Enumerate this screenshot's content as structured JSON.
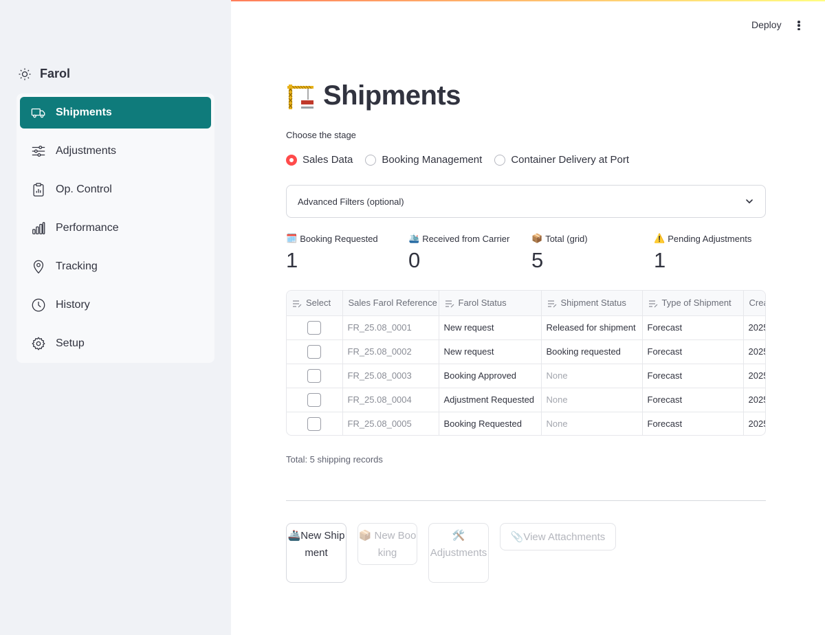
{
  "app": {
    "brand": "Farol"
  },
  "header": {
    "deploy_label": "Deploy"
  },
  "sidebar": {
    "items": [
      {
        "label": "Shipments",
        "icon": "truck-icon",
        "active": true
      },
      {
        "label": "Adjustments",
        "icon": "sliders-icon"
      },
      {
        "label": "Op. Control",
        "icon": "clipboard-icon"
      },
      {
        "label": "Performance",
        "icon": "bar-chart-icon"
      },
      {
        "label": "Tracking",
        "icon": "map-pin-icon"
      },
      {
        "label": "History",
        "icon": "clock-icon"
      },
      {
        "label": "Setup",
        "icon": "gear-icon"
      }
    ]
  },
  "page": {
    "title": "Shipments",
    "title_emoji": "🏗️",
    "stage_label": "Choose the stage",
    "stages": [
      "Sales Data",
      "Booking Management",
      "Container Delivery at Port"
    ],
    "selected_stage": "Sales Data",
    "filters_label": "Advanced Filters (optional)"
  },
  "metrics": [
    {
      "emoji": "🗓️",
      "label": "Booking Requested",
      "value": "1"
    },
    {
      "emoji": "🛳️",
      "label": "Received from Carrier",
      "value": "0"
    },
    {
      "emoji": "📦",
      "label": "Total (grid)",
      "value": "5"
    },
    {
      "emoji": "⚠️",
      "label": "Pending Adjustments",
      "value": "1"
    }
  ],
  "grid": {
    "columns": [
      "Select",
      "Sales Farol Reference",
      "Farol Status",
      "Shipment Status",
      "Type of Shipment",
      "Crea"
    ],
    "rows": [
      [
        "FR_25.08_0001",
        "New request",
        "Released for shipment",
        "Forecast",
        "2025"
      ],
      [
        "FR_25.08_0002",
        "New request",
        "Booking requested",
        "Forecast",
        "2025"
      ],
      [
        "FR_25.08_0003",
        "Booking Approved",
        "None",
        "Forecast",
        "2025"
      ],
      [
        "FR_25.08_0004",
        "Adjustment Requested",
        "None",
        "Forecast",
        "2025"
      ],
      [
        "FR_25.08_0005",
        "Booking Requested",
        "None",
        "Forecast",
        "2025"
      ]
    ]
  },
  "total_text": "Total: 5 shipping records",
  "actions": {
    "new_shipment": {
      "emoji": "🚢",
      "label": "New Shipment"
    },
    "new_booking": {
      "emoji": "📦",
      "label": "New Booking"
    },
    "adjustments": {
      "emoji": "🛠️",
      "label": "Adjustments"
    },
    "view_attachments": {
      "emoji": "📎",
      "label": "View Attachments"
    }
  },
  "colors": {
    "accent": "#0f7b7b",
    "radio": "#ff4b4b",
    "sidebar_bg": "#f0f2f6"
  }
}
